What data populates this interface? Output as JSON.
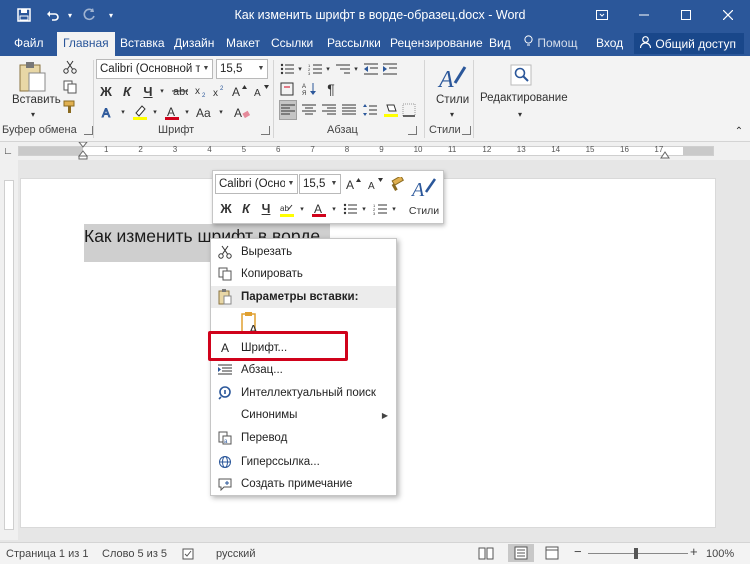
{
  "window": {
    "title": "Как изменить шрифт в ворде-образец.docx - Word",
    "save_icon": "save-icon",
    "undo_icon": "undo-icon",
    "redo_icon": "redo-icon",
    "customize_icon": "chevron-down-icon",
    "controls": [
      "ribbon-options-icon",
      "minimize-icon",
      "maximize-icon",
      "close-icon"
    ]
  },
  "tabs": [
    {
      "label": "Файл"
    },
    {
      "label": "Главная"
    },
    {
      "label": "Вставка"
    },
    {
      "label": "Дизайн"
    },
    {
      "label": "Макет"
    },
    {
      "label": "Ссылки"
    },
    {
      "label": "Рассылки"
    },
    {
      "label": "Рецензирование"
    },
    {
      "label": "Вид"
    }
  ],
  "help": {
    "label": "Помощ"
  },
  "signin": {
    "label": "Вход"
  },
  "share": {
    "label": "Общий доступ"
  },
  "ribbon": {
    "clipboard": {
      "paste_label": "Вставить",
      "group_label": "Буфер обмена"
    },
    "font": {
      "name": "Calibri (Основной тег",
      "size": "15,5",
      "group_label": "Шрифт",
      "bold": "Ж",
      "italic": "К",
      "underline": "Ч"
    },
    "paragraph": {
      "group_label": "Абзац"
    },
    "styles": {
      "label": "Стили",
      "group_label": "Стили"
    },
    "editing": {
      "label": "Редактирование"
    }
  },
  "ruler": {
    "ticks": [
      "1",
      "2",
      "3",
      "4",
      "5",
      "6",
      "7",
      "8",
      "9",
      "10",
      "11",
      "12",
      "13",
      "14",
      "15",
      "16",
      "17"
    ]
  },
  "document": {
    "text": "Как изменить шрифт в ворде"
  },
  "mini_toolbar": {
    "font_name": "Calibri (Осно",
    "font_size": "15,5",
    "bold": "Ж",
    "italic": "К",
    "underline": "Ч",
    "styles_label": "Стили"
  },
  "context_menu": {
    "items": [
      {
        "label": "Вырезать",
        "icon": "scissors-icon"
      },
      {
        "label": "Копировать",
        "icon": "copy-icon"
      },
      {
        "label": "Параметры вставки:",
        "icon": "paste-icon"
      },
      {
        "label": "",
        "icon": "paste-text-only-icon"
      },
      {
        "label": "Шрифт...",
        "icon": "font-icon"
      },
      {
        "label": "Абзац...",
        "icon": "paragraph-icon"
      },
      {
        "label": "Интеллектуальный поиск",
        "icon": "smart-lookup-icon"
      },
      {
        "label": "Синонимы",
        "icon": ""
      },
      {
        "label": "Перевод",
        "icon": "translate-icon"
      },
      {
        "label": "Гиперссылка...",
        "icon": "hyperlink-icon"
      },
      {
        "label": "Создать примечание",
        "icon": "comment-icon"
      }
    ],
    "highlight_color": "#d0021b"
  },
  "status": {
    "page": "Страница 1 из 1",
    "words": "Слово 5 из 5",
    "language": "русский",
    "zoom": "100%"
  },
  "colors": {
    "brand": "#2b579a",
    "highlight": "#ffff00",
    "font_color": "#d0021b"
  }
}
